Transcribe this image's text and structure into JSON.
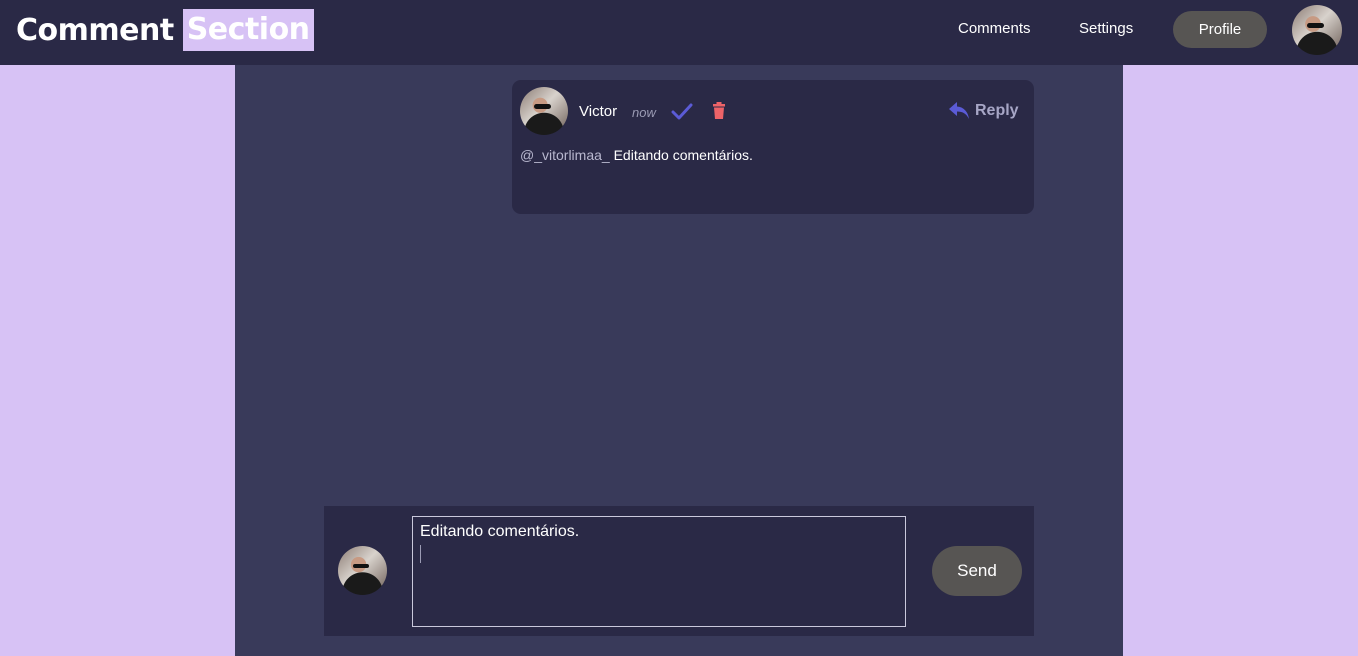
{
  "header": {
    "title_part1": "Comment",
    "title_part2": "Section",
    "nav": {
      "comments": "Comments",
      "settings": "Settings",
      "profile": "Profile"
    }
  },
  "comment": {
    "username": "Victor",
    "time": "now",
    "reply_label": "Reply",
    "mention": "@_vitorlimaa_",
    "text": "Editando comentários."
  },
  "composer": {
    "value": "Editando comentários.",
    "send_label": "Send"
  },
  "colors": {
    "header_bg": "#2a2946",
    "page_bg": "#d7c2f5",
    "main_bg": "#393a5a",
    "accent": "#5b5bd6",
    "delete": "#ed6368",
    "button_bg": "#575553"
  },
  "icons": {
    "edit_confirm": "check-icon",
    "delete": "trash-icon",
    "reply": "reply-arrow-icon"
  }
}
